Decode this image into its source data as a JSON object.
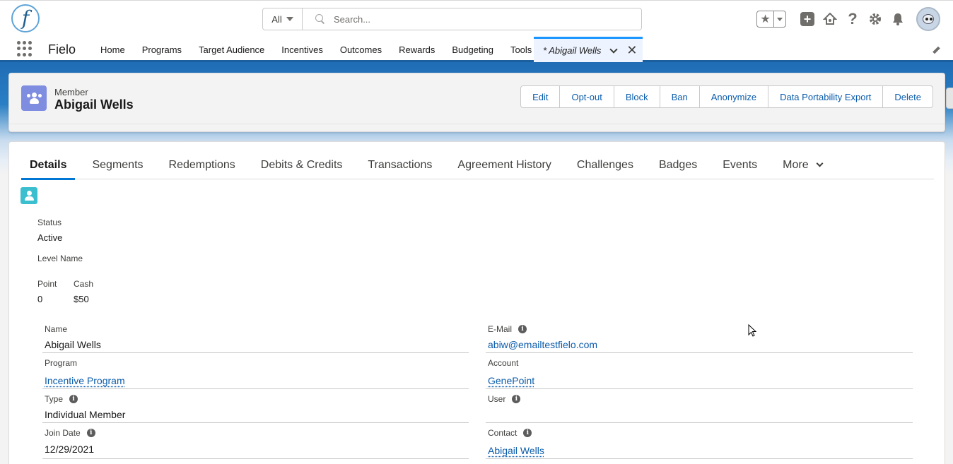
{
  "header": {
    "logo_letter": "f",
    "search_scope": "All",
    "search_placeholder": "Search...",
    "icons": [
      "favorites-star-icon",
      "favorites-dropdown-icon",
      "global-add-icon",
      "trailhead-icon",
      "help-icon",
      "setup-gear-icon",
      "notifications-bell-icon",
      "user-avatar"
    ]
  },
  "nav": {
    "app_name": "Fielo",
    "items": [
      "Home",
      "Programs",
      "Target Audience",
      "Incentives",
      "Outcomes",
      "Rewards",
      "Budgeting",
      "Tools"
    ],
    "active_tab": "* Abigail Wells",
    "close_glyph": "✕"
  },
  "record": {
    "type": "Member",
    "name": "Abigail Wells",
    "actions": [
      "Edit",
      "Opt-out",
      "Block",
      "Ban",
      "Anonymize",
      "Data Portability Export",
      "Delete"
    ]
  },
  "tabs": {
    "items": [
      "Details",
      "Segments",
      "Redemptions",
      "Debits & Credits",
      "Transactions",
      "Agreement History",
      "Challenges",
      "Badges",
      "Events"
    ],
    "more": "More",
    "active_index": 0
  },
  "summary": {
    "status_label": "Status",
    "status_value": "Active",
    "level_label": "Level Name",
    "level_value": "",
    "point_label": "Point",
    "point_value": "0",
    "cash_label": "Cash",
    "cash_value": "$50"
  },
  "fields": {
    "left": [
      {
        "label": "Name",
        "value": "Abigail Wells",
        "info": false,
        "link": false
      },
      {
        "label": "Program",
        "value": "Incentive Program",
        "info": false,
        "link": true
      },
      {
        "label": "Type",
        "value": "Individual Member",
        "info": true,
        "link": false
      },
      {
        "label": "Join Date",
        "value": "12/29/2021",
        "info": true,
        "link": false
      }
    ],
    "right": [
      {
        "label": "E-Mail",
        "value": "abiw@emailtestfielo.com",
        "info": true,
        "link": true
      },
      {
        "label": "Account",
        "value": "GenePoint",
        "info": false,
        "link": true
      },
      {
        "label": "User",
        "value": "",
        "info": true,
        "link": false
      },
      {
        "label": "Contact",
        "value": "Abigail Wells",
        "info": true,
        "link": true
      }
    ]
  },
  "colors": {
    "brand_blue": "#0176d3",
    "link_blue": "#0b5cab",
    "record_icon": "#7f8de1",
    "contact_icon": "#3bbfcf"
  }
}
